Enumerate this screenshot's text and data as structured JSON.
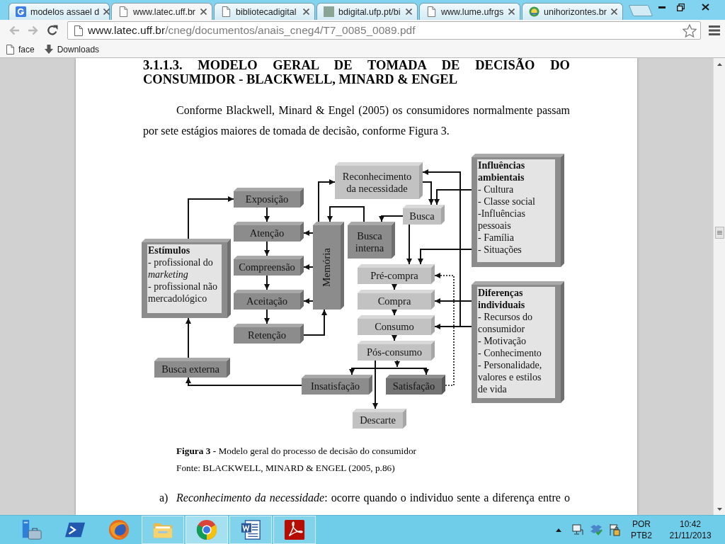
{
  "browser": {
    "tabs": [
      {
        "title": "modelos assael d",
        "selected": false
      },
      {
        "title": "www.latec.uff.br",
        "selected": true
      },
      {
        "title": "bibliotecadigital",
        "selected": false
      },
      {
        "title": "bdigital.ufp.pt/bi",
        "selected": false
      },
      {
        "title": "www.lume.ufrgs",
        "selected": false
      },
      {
        "title": "unihorizontes.br",
        "selected": false
      }
    ],
    "toolbar": {
      "back": {
        "disabled": true
      },
      "forward": {
        "disabled": true
      }
    },
    "address": {
      "host": "www.latec.uff.br",
      "path": "/cneg/documentos/anais_cneg4/T7_0085_0089.pdf"
    },
    "bookmarks": [
      {
        "label": "face"
      },
      {
        "label": "Downloads"
      }
    ]
  },
  "document": {
    "heading": "3.1.1.3. MODELO GERAL DE TOMADA DE DECISÃO DO CONSUMIDOR - BLACKWELL, MINARD & ENGEL",
    "paragraph": "Conforme Blackwell, Minard & Engel (2005) os consumidores normalmente passam por sete estágios maiores de tomada de decisão, conforme Figura 3.",
    "figure": {
      "nodes": [
        {
          "kind": "panel",
          "title": "Influências ambientais",
          "items": [
            "- Cultura",
            "- Classe social",
            "-Influências pessoais",
            "- Família",
            "- Situações"
          ]
        },
        {
          "kind": "light",
          "label": "Reconhecimento da necessidade"
        },
        {
          "kind": "dark",
          "label": "Exposição"
        },
        {
          "kind": "light",
          "label": "Busca"
        },
        {
          "kind": "dark",
          "label": "Atenção"
        },
        {
          "kind": "vertical",
          "label": "Memória"
        },
        {
          "kind": "dark",
          "label": "Busca interna"
        },
        {
          "kind": "panel",
          "title": "Estímulos",
          "items": [
            "- profissional do *marketing*",
            "- profissional não mercadológico"
          ]
        },
        {
          "kind": "dark",
          "label": "Compreensão"
        },
        {
          "kind": "light",
          "label": "Pré-compra"
        },
        {
          "kind": "panel",
          "title": "Diferenças individuais",
          "items": [
            "- Recursos do consumidor",
            "- Motivação",
            "- Conhecimento",
            "- Personalidade, valores e estilos de vida"
          ]
        },
        {
          "kind": "dark",
          "label": "Aceitação"
        },
        {
          "kind": "light",
          "label": "Compra"
        },
        {
          "kind": "light",
          "label": "Consumo"
        },
        {
          "kind": "dark",
          "label": "Retenção"
        },
        {
          "kind": "light",
          "label": "Pós-consumo"
        },
        {
          "kind": "dark",
          "label": "Busca externa"
        },
        {
          "kind": "dark",
          "label": "Insatisfação"
        },
        {
          "kind": "deep",
          "label": "Satisfação"
        },
        {
          "kind": "light",
          "label": "Descarte"
        }
      ]
    },
    "caption": "**Figura 3 -** Modelo geral do processo de decisão do consumidor",
    "source": "Fonte: BLACKWELL, MINARD & ENGEL (2005, p.86)",
    "list_items": [
      {
        "marker": "a)",
        "text": "*Reconhecimento da necessidade*: ocorre quando o individuo sente a diferença entre o"
      }
    ]
  },
  "taskbar": {
    "apps": [
      {
        "running": false,
        "selected": false
      },
      {
        "running": false,
        "selected": false
      },
      {
        "running": false,
        "selected": false
      },
      {
        "running": true,
        "selected": false
      },
      {
        "running": true,
        "selected": true
      },
      {
        "running": true,
        "selected": false
      },
      {
        "running": true,
        "selected": false
      }
    ],
    "tray": {
      "language": "POR",
      "layout": "PTB2",
      "time": "10:42",
      "date": "21/11/2013"
    }
  }
}
